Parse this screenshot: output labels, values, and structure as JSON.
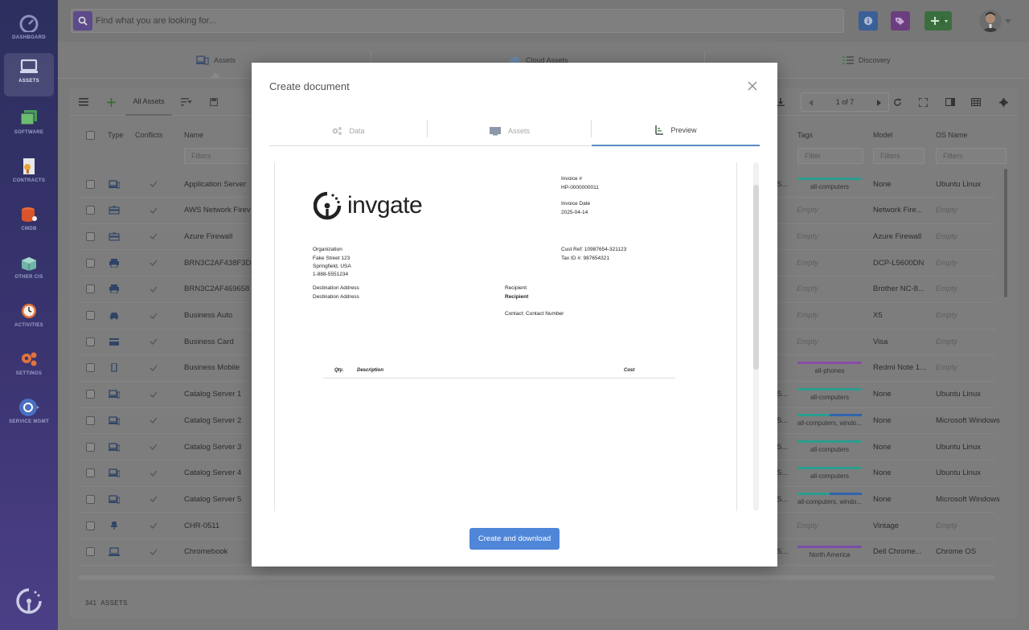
{
  "sidebar": {
    "items": [
      {
        "label": "DASHBOARD"
      },
      {
        "label": "ASSETS"
      },
      {
        "label": "SOFTWARE"
      },
      {
        "label": "CONTRACTS"
      },
      {
        "label": "CMDB"
      },
      {
        "label": "OTHER CIS"
      },
      {
        "label": "ACTIVITIES"
      },
      {
        "label": "SETTINGS"
      },
      {
        "label": "SERVICE MGMT"
      }
    ]
  },
  "search": {
    "placeholder": "Find what you are looking for..."
  },
  "section_tabs": [
    {
      "label": "Assets"
    },
    {
      "label": "Cloud Assets"
    },
    {
      "label": "Discovery"
    }
  ],
  "toolbar": {
    "all_assets": "All Assets",
    "page": "1 of 7"
  },
  "grid": {
    "headers": {
      "type": "Type",
      "conflicts": "Conflicts",
      "name": "Name",
      "tags": "Tags",
      "model": "Model",
      "os_name": "OS Name"
    },
    "filter_placeholder": "Filters",
    "filter_placeholder_alt": "Filter",
    "rows": [
      {
        "name": "Application Server",
        "tag": "all-computers",
        "model": "None",
        "os": "Ubuntu Linux",
        "cut": "S..."
      },
      {
        "name": "AWS Network Firev",
        "tag": "Empty",
        "model": "Network Fire...",
        "os": "Empty",
        "cut": ""
      },
      {
        "name": "Azure Firewall",
        "tag": "Empty",
        "model": "Azure Firewall",
        "os": "Empty",
        "cut": ""
      },
      {
        "name": "BRN3C2AF438F3D",
        "tag": "Empty",
        "model": "DCP-L5600DN",
        "os": "Empty",
        "cut": ""
      },
      {
        "name": "BRN3C2AF469658",
        "tag": "Empty",
        "model": "Brother NC-8...",
        "os": "Empty",
        "cut": ""
      },
      {
        "name": "Business Auto",
        "tag": "Empty",
        "model": "X5",
        "os": "Empty",
        "cut": ""
      },
      {
        "name": "Business Card",
        "tag": "Empty",
        "model": "Visa",
        "os": "Empty",
        "cut": ""
      },
      {
        "name": "Business Mobile",
        "tag": "all-phones",
        "model": "Redmi Note 1...",
        "os": "Empty",
        "cut": ""
      },
      {
        "name": "Catalog Server 1",
        "tag": "all-computers",
        "model": "None",
        "os": "Ubuntu Linux",
        "cut": "S..."
      },
      {
        "name": "Catalog Server 2",
        "tag": "all-computers, windo...",
        "model": "None",
        "os": "Microsoft Windows",
        "cut": "S..."
      },
      {
        "name": "Catalog Server 3",
        "tag": "all-computers",
        "model": "None",
        "os": "Ubuntu Linux",
        "cut": "S..."
      },
      {
        "name": "Catalog Server 4",
        "tag": "all-computers",
        "model": "None",
        "os": "Ubuntu Linux",
        "cut": "S..."
      },
      {
        "name": "Catalog Server 5",
        "tag": "all-computers, windo...",
        "model": "None",
        "os": "Microsoft Windows",
        "cut": "S..."
      },
      {
        "name": "CHR-0511",
        "tag": "Empty",
        "model": "Vintage",
        "os": "Empty",
        "cut": ""
      },
      {
        "name": "Chromebook",
        "tag": "North America",
        "model": "Dell Chrome...",
        "os": "Chrome OS",
        "cut": "S..."
      }
    ]
  },
  "footer": {
    "count": "341",
    "label": "ASSETS"
  },
  "modal": {
    "title": "Create document",
    "tabs": [
      {
        "label": "Data"
      },
      {
        "label": "Assets"
      },
      {
        "label": "Preview"
      }
    ],
    "button": "Create and download",
    "doc": {
      "brand": "invgate",
      "invoice_no_label": "Invoice #",
      "invoice_no": "HP-0000000011",
      "invoice_date_label": "Invoice Date",
      "invoice_date": "2025-04-14",
      "org_lines": [
        "Organization",
        "Fake Street 123",
        "Springfield, USA",
        "1-888-5551234"
      ],
      "cust_ref": "Cust Ref: 10987654-321123",
      "tax_id": "Tax ID #: 987654321",
      "dest1": "Destination Address",
      "dest2": "Destination Address",
      "recipient1": "Recipient",
      "recipient2": "Recipient",
      "contact": "Contact: Contact Number",
      "col_qty": "Qty.",
      "col_desc": "Description",
      "col_cost": "Cost"
    }
  }
}
